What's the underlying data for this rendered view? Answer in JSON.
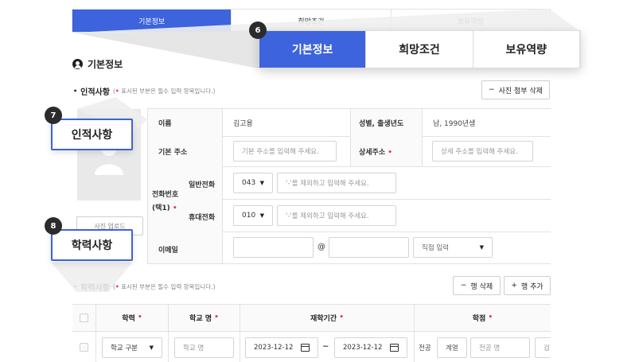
{
  "tabs": [
    "기본정보",
    "희망조건",
    "보유역량"
  ],
  "callouts": {
    "badge_6": "6",
    "badge_7": "7",
    "badge_8": "8",
    "zoom_personal": "인적사항",
    "zoom_education": "학력사항"
  },
  "section": {
    "title": "기본정보"
  },
  "personal": {
    "title": "인적사항",
    "hint": "표시된 부분은 필수 입력 항목입니다.)",
    "hint_prefix": "(",
    "delete_photo": "사진 첨부 삭제",
    "photo_button": "사진 업로드",
    "name_label": "이름",
    "name_value": "김고용",
    "gender_label": "성별, 출생년도",
    "gender_value": "남, 1990년생",
    "address_label": "기본 주소",
    "address_placeholder": "기본 주소를 입력해 주세요.",
    "detail_address_label": "상세주소",
    "detail_address_placeholder": "상세 주소를 입력해 주세요.",
    "phone_group_label_1": "전화번호",
    "phone_group_label_2": "(택1)",
    "landline_label": "일반전화",
    "landline_code": "043",
    "mobile_label": "휴대전화",
    "mobile_code": "010",
    "phone_placeholder": "'-'를 제외하고 입력해 주세요.",
    "email_label": "이메일",
    "email_at": "@",
    "email_domain_select": "직접 입력"
  },
  "education": {
    "title": "학력사항",
    "hint_prefix": "(",
    "hint": "표시된 부분은 필수 입력 항목입니다.)",
    "delete_row": "행 삭제",
    "add_row": "행 추가",
    "headers": [
      "학력",
      "학교 명",
      "재학기간",
      "학점"
    ],
    "row": {
      "degree_select": "학교 구분",
      "school_placeholder": "학교 명",
      "start_date": "2023-12-12",
      "tilde": "~",
      "end_date": "2023-12-12",
      "major_label": "전공",
      "major_type": "계열",
      "major_placeholder": "전공 명",
      "grade_partial": "검"
    }
  },
  "colors": {
    "accent": "#3d63dd",
    "required": "#e23b4c"
  }
}
